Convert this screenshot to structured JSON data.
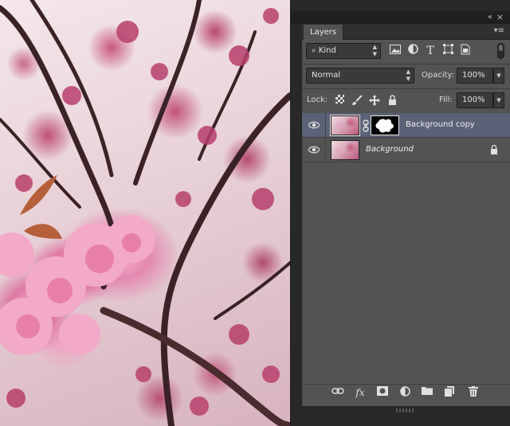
{
  "panel": {
    "collapse_glyph": "«",
    "close_glyph": "×",
    "menu_glyph": "▾≡"
  },
  "tabs": [
    {
      "label": "Layers",
      "active": true
    }
  ],
  "filter": {
    "kind_label": "Kind",
    "icons": [
      "image-filter-icon",
      "adjustment-filter-icon",
      "type-filter-icon",
      "shape-filter-icon",
      "smart-object-filter-icon"
    ]
  },
  "blend": {
    "mode": "Normal",
    "opacity_label": "Opacity:",
    "opacity_value": "100%"
  },
  "lock": {
    "label": "Lock:",
    "fill_label": "Fill:",
    "fill_value": "100%"
  },
  "layers": [
    {
      "name": "Background copy",
      "visible": true,
      "selected": true,
      "has_mask": true,
      "italic": false,
      "locked": false
    },
    {
      "name": "Background",
      "visible": true,
      "selected": false,
      "has_mask": false,
      "italic": true,
      "locked": true
    }
  ],
  "footer": {
    "fx_label": "fx",
    "icons": [
      "link-layers-icon",
      "fx-icon",
      "add-mask-icon",
      "adjustment-layer-icon",
      "new-group-icon",
      "new-layer-icon",
      "trash-icon"
    ]
  },
  "colors": {
    "panel_bg": "#535353",
    "selected_row": "#5b6176",
    "app_bg": "#282828"
  }
}
